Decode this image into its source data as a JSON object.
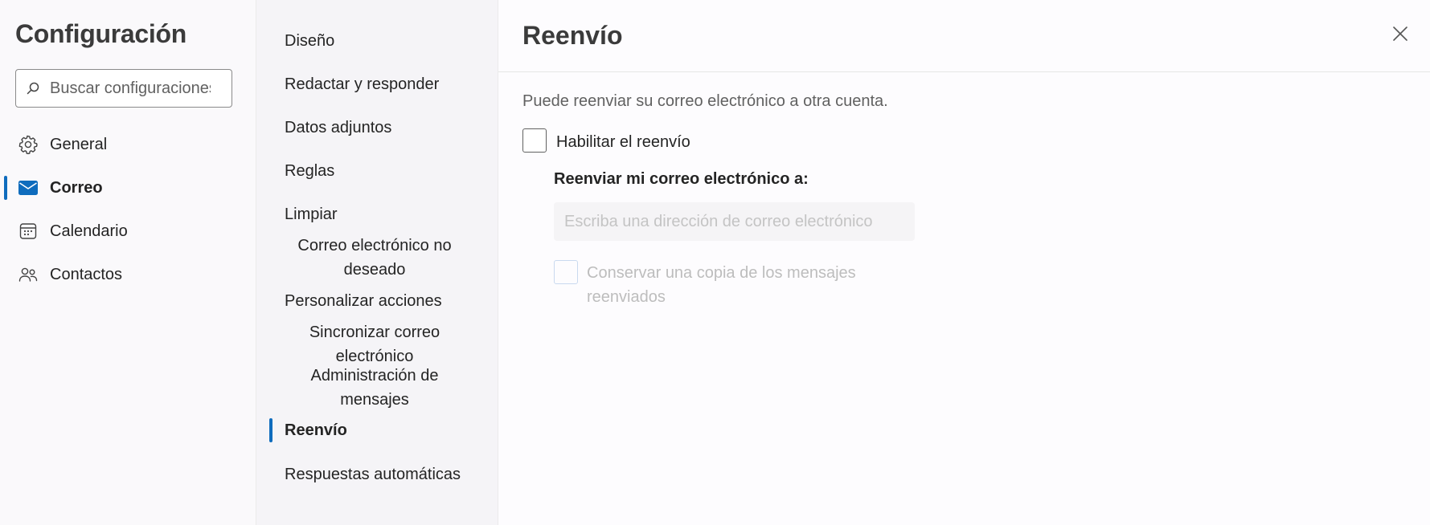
{
  "left": {
    "title": "Configuración",
    "search_placeholder": "Buscar configuraciones",
    "categories": [
      {
        "label": "General",
        "icon": "gear-icon"
      },
      {
        "label": "Correo",
        "icon": "mail-icon",
        "selected": true
      },
      {
        "label": "Calendario",
        "icon": "calendar-icon"
      },
      {
        "label": "Contactos",
        "icon": "people-icon"
      }
    ]
  },
  "middle": {
    "items": [
      {
        "label": "Diseño"
      },
      {
        "label": "Redactar y responder"
      },
      {
        "label": "Datos adjuntos"
      },
      {
        "label": "Reglas"
      },
      {
        "label": "Limpiar"
      },
      {
        "label": "Correo electrónico no deseado"
      },
      {
        "label": "Personalizar acciones"
      },
      {
        "label": "Sincronizar correo electrónico"
      },
      {
        "label": "Administración de mensajes"
      },
      {
        "label": "Reenvío",
        "selected": true
      },
      {
        "label": "Respuestas automáticas"
      }
    ]
  },
  "main": {
    "title": "Reenvío",
    "description": "Puede reenviar su correo electrónico a otra cuenta.",
    "enable_label": "Habilitar el reenvío",
    "enable_checked": false,
    "forward_to_label": "Reenviar mi correo electrónico a:",
    "address_placeholder": "Escriba una dirección de correo electrónico",
    "address_value": "",
    "keep_copy_label": "Conservar una copia de los mensajes reenviados",
    "keep_copy_checked": false
  },
  "colors": {
    "accent": "#0f6cbd"
  }
}
